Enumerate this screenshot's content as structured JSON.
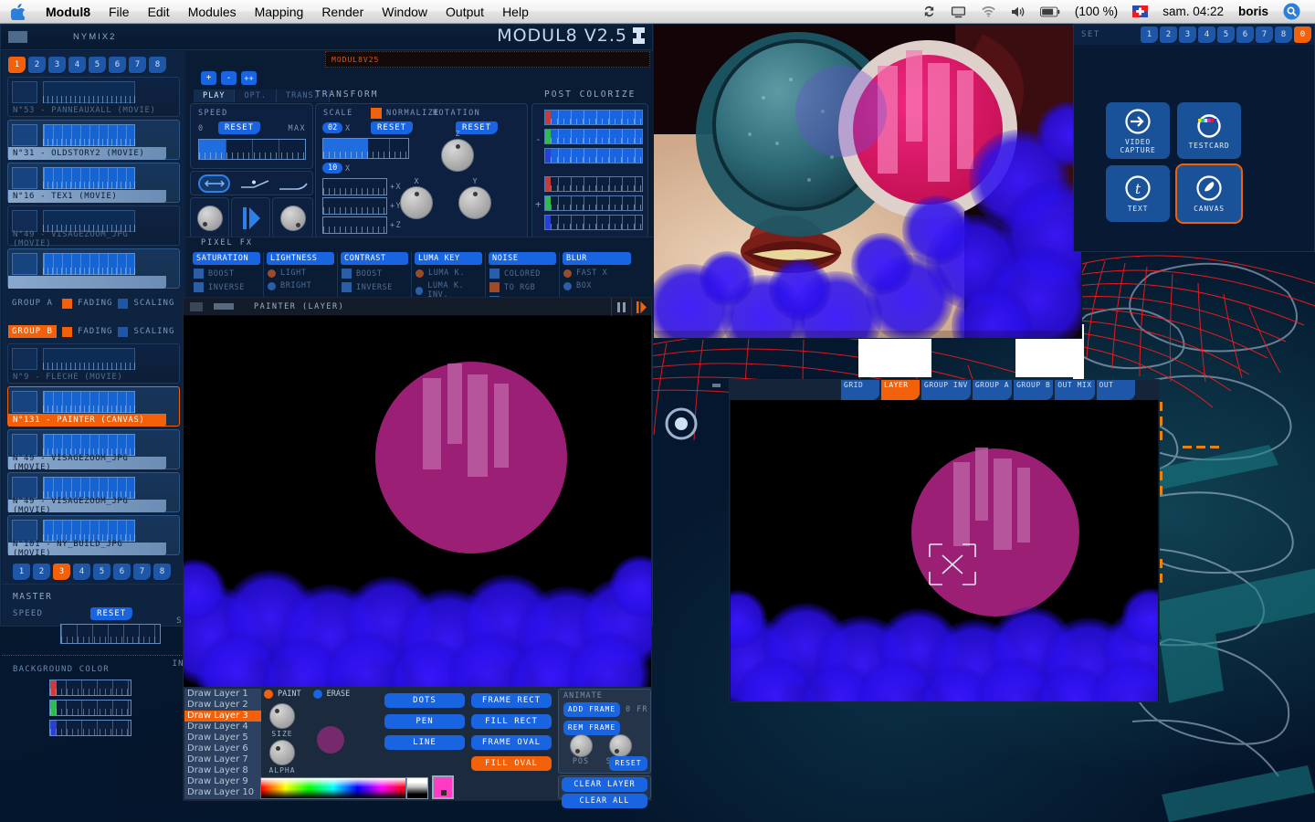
{
  "menubar": {
    "apple_icon": "apple-icon",
    "items": [
      "Modul8",
      "File",
      "Edit",
      "Modules",
      "Mapping",
      "Render",
      "Window",
      "Output",
      "Help"
    ],
    "right": {
      "sync_icon": "sync-icon",
      "display_icon": "display-icon",
      "wifi_icon": "wifi-icon",
      "volume_icon": "volume-icon",
      "battery_icon": "battery-icon",
      "battery_percent": "(100 %)",
      "flag_icon": "swiss-flag-icon",
      "clock": "sam. 04:22",
      "user": "boris",
      "search_icon": "spotlight-search-icon"
    }
  },
  "main_window": {
    "doc_name": "NYMIX2",
    "app_title": "MODUL8 V2.5",
    "preset_name": "MODUL8V25",
    "banks": [
      "1",
      "2",
      "3",
      "4",
      "5",
      "6",
      "7",
      "8"
    ],
    "bank_selected": "1",
    "bank_buttons": [
      "+",
      "-",
      "++"
    ]
  },
  "group_a": {
    "label": "GROUP A",
    "fading_label": "FADING",
    "scaling_label": "SCALING",
    "layers": [
      {
        "name": "N°53 - PANNEAUXALL (MOVIE)",
        "state": "dim"
      },
      {
        "name": "N°31 - OLDSTORY2 (MOVIE)",
        "state": "on"
      },
      {
        "name": "N°16 - TEX1 (MOVIE)",
        "state": "on"
      },
      {
        "name": "N°49 - VISAGEZOOM_JPG (MOVIE)",
        "state": "dim"
      },
      {
        "name": "",
        "state": "on"
      }
    ]
  },
  "group_b": {
    "label": "GROUP B",
    "fading_label": "FADING",
    "scaling_label": "SCALING",
    "layers": [
      {
        "name": "N°9 - FLECHE (MOVIE)",
        "state": "dim"
      },
      {
        "name": "N°131 - PAINTER (CANVAS)",
        "state": "selected"
      },
      {
        "name": "N°49 - VISAGEZOOM_JPG (MOVIE)",
        "state": "on"
      },
      {
        "name": "N°49 - VISAGEZOOM_JPG (MOVIE)",
        "state": "on"
      },
      {
        "name": "N°101 - NY_BUILD_JPG (MOVIE)",
        "state": "on"
      }
    ],
    "banks": [
      "1",
      "2",
      "3",
      "4",
      "5",
      "6",
      "7",
      "8"
    ],
    "bank_selected": "3"
  },
  "master": {
    "title": "MASTER",
    "speed_label": "SPEED",
    "speed_reset": "RESET",
    "scale_label": "SCA",
    "bg_color_label": "BACKGROUND COLOR",
    "invert_label": "INVE",
    "bg_channels": [
      {
        "name": "red",
        "color": "#d23a3a",
        "value": 0
      },
      {
        "name": "green",
        "color": "#2fbb4e",
        "value": 0
      },
      {
        "name": "blue",
        "color": "#2a3fd6",
        "value": 0
      }
    ]
  },
  "control_panel": {
    "tabs": [
      {
        "label": "PLAY",
        "selected": true
      },
      {
        "label": "OPT.",
        "selected": false
      },
      {
        "label": "TRANS.",
        "selected": false
      }
    ],
    "speed": {
      "title": "SPEED",
      "min_label": "0",
      "max_label": "MAX",
      "reset": "RESET",
      "value_pct": 25
    },
    "play_icons": [
      "loop-icon",
      "ramp-icon",
      "fade-icon"
    ],
    "play_knobs": [
      "knob-left",
      "play-icon",
      "knob-right"
    ],
    "transform": {
      "title": "TRANSFORM",
      "scale_label": "SCALE",
      "normalize_label": "NORMALIZE",
      "reset": "RESET",
      "scale_value": "02",
      "scale_unit": "X",
      "keystone_value": "10",
      "keystone_unit": "X",
      "axes": [
        "+X",
        "+Y",
        "+Z"
      ],
      "scale_fill_pct": 53
    },
    "rotation": {
      "title": "ROTATION",
      "reset": "RESET",
      "knobs": [
        "Z",
        "X",
        "Y"
      ]
    },
    "post_colorize": {
      "title": "POST COLORIZE",
      "minus_label": "-",
      "plus_label": "+",
      "minus_channels": [
        {
          "name": "red",
          "color": "#c93a3a",
          "filled": true
        },
        {
          "name": "green",
          "color": "#2fbb4e",
          "filled": true
        },
        {
          "name": "blue",
          "color": "#2a3fd6",
          "filled": true
        }
      ],
      "plus_channels": [
        {
          "name": "red",
          "color": "#c93a3a",
          "filled": false
        },
        {
          "name": "green",
          "color": "#2fbb4e",
          "filled": false
        },
        {
          "name": "blue",
          "color": "#2a3fd6",
          "filled": false
        }
      ]
    }
  },
  "pixel_fx": {
    "title": "PIXEL FX",
    "columns": [
      {
        "header": "SATURATION",
        "options": [
          {
            "label": "BOOST",
            "kind": "square",
            "color": "blue"
          },
          {
            "label": "INVERSE",
            "kind": "square",
            "color": "blue"
          }
        ]
      },
      {
        "header": "LIGHTNESS",
        "options": [
          {
            "label": "LIGHT",
            "kind": "round",
            "color": "orange"
          },
          {
            "label": "BRIGHT",
            "kind": "round",
            "color": "blue"
          }
        ]
      },
      {
        "header": "CONTRAST",
        "options": [
          {
            "label": "BOOST",
            "kind": "square",
            "color": "blue"
          },
          {
            "label": "INVERSE",
            "kind": "square",
            "color": "blue"
          }
        ]
      },
      {
        "header": "LUMA KEY",
        "options": [
          {
            "label": "LUMA K.",
            "kind": "round",
            "color": "orange"
          },
          {
            "label": "LUMA K. INV.",
            "kind": "round",
            "color": "blue"
          }
        ]
      },
      {
        "header": "NOISE",
        "options": [
          {
            "label": "COLORED",
            "kind": "square",
            "color": "blue"
          },
          {
            "label": "TO RGB",
            "kind": "square",
            "color": "orange"
          },
          {
            "label": "TO ALPHA",
            "kind": "square",
            "color": "blue"
          }
        ]
      },
      {
        "header": "BLUR",
        "options": [
          {
            "label": "FAST X",
            "kind": "round",
            "color": "orange"
          },
          {
            "label": "BOX",
            "kind": "round",
            "color": "blue"
          }
        ]
      }
    ]
  },
  "painter": {
    "title": "PAINTER (LAYER)",
    "pause_icon": "pause-icon",
    "play_icon": "play-icon",
    "draw_layers": [
      "Draw Layer 1",
      "Draw Layer 2",
      "Draw Layer 3",
      "Draw Layer 4",
      "Draw Layer 5",
      "Draw Layer 6",
      "Draw Layer 7",
      "Draw Layer 8",
      "Draw Layer 9",
      "Draw Layer 10"
    ],
    "draw_layer_selected": "Draw Layer 3",
    "modes": [
      {
        "label": "PAINT",
        "color": "#f26109",
        "selected": true
      },
      {
        "label": "ERASE",
        "color": "#1964e0",
        "selected": false
      }
    ],
    "size_label": "SIZE",
    "alpha_label": "ALPHA",
    "tools_left": [
      "DOTS",
      "PEN",
      "LINE"
    ],
    "tools_right": [
      "FRAME RECT",
      "FILL RECT",
      "FRAME OVAL",
      "FILL OVAL"
    ],
    "tool_selected": "FILL OVAL",
    "animate": {
      "title": "ANIMATE",
      "add_frame": "ADD FRAME",
      "rem_frame": "REM FRAME",
      "frame_count": "0 FR",
      "pos_label": "POS",
      "speed_label": "SPEED",
      "reset": "RESET"
    },
    "clear_layer": "CLEAR LAYER",
    "clear_all": "CLEAR ALL",
    "current_color": "#ff3bc4"
  },
  "preview": {
    "tabs": [
      {
        "label": "GRID",
        "selected": false
      },
      {
        "label": "LAYER",
        "selected": true
      },
      {
        "label": "GROUP INV",
        "selected": false
      },
      {
        "label": "GROUP A",
        "selected": false
      },
      {
        "label": "GROUP B",
        "selected": false
      },
      {
        "label": "OUT MIX",
        "selected": false
      },
      {
        "label": "OUT",
        "selected": false
      }
    ]
  },
  "right_panel": {
    "header_label": "SET",
    "banks": [
      "1",
      "2",
      "3",
      "4",
      "5",
      "6",
      "7",
      "8",
      "0"
    ],
    "bank_selected": "0",
    "media_buttons": [
      {
        "label": "VIDEO\nCAPTURE",
        "icon": "video-capture-icon",
        "selected": false
      },
      {
        "label": "TESTCARD",
        "icon": "testcard-icon",
        "selected": false
      },
      {
        "label": "TEXT",
        "icon": "text-icon",
        "selected": false
      },
      {
        "label": "CANVAS",
        "icon": "canvas-icon",
        "selected": true
      }
    ]
  },
  "colors": {
    "accent_orange": "#f26109",
    "accent_blue": "#1964e0",
    "panel_dark": "#0a1c33",
    "panel_mid": "#0e2340"
  }
}
